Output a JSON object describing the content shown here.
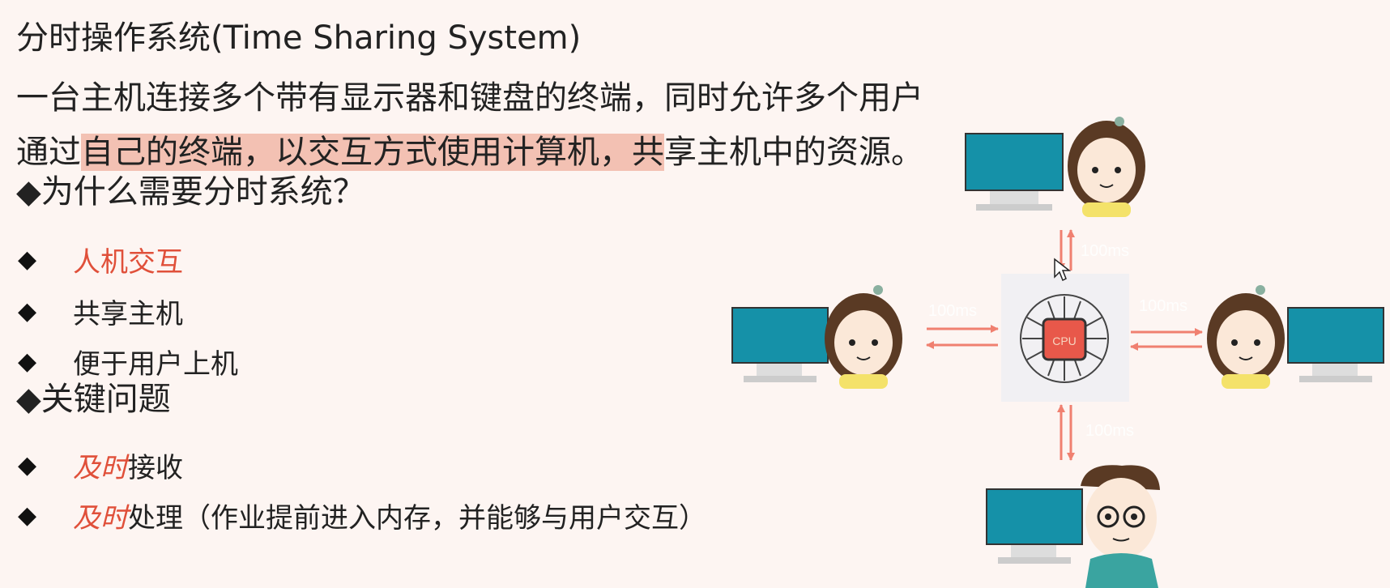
{
  "title": "分时操作系统(Time Sharing System)",
  "intro": {
    "line1": "一台主机连接多个带有显示器和键盘的终端，同时允许多个用户",
    "line2_pre": "通过",
    "line2_hl": "自己的终端，以交互方式使用计算机，共",
    "line2_post": "享主机中的资源。"
  },
  "why": {
    "heading": "◆为什么需要分时系统？",
    "items": [
      {
        "text": "人机交互",
        "highlight": true
      },
      {
        "text": "共享主机",
        "highlight": false
      },
      {
        "text": "便于用户上机",
        "highlight": false
      }
    ]
  },
  "key": {
    "heading": "◆关键问题",
    "items": [
      {
        "em": "及时",
        "text": " 接收"
      },
      {
        "em": "及时",
        "text": " 处理（作业提前进入内存，并能够与用户交互）"
      }
    ]
  },
  "bullet_glyph": "◆",
  "diagram": {
    "cpu_label": "CPU",
    "latency_labels": [
      "100ms",
      "100ms",
      "100ms",
      "100ms"
    ]
  },
  "colors": {
    "accent": "#e0503a",
    "highlight": "#f3c1b3",
    "monitor": "#1591a8",
    "arrow": "#f08070"
  }
}
